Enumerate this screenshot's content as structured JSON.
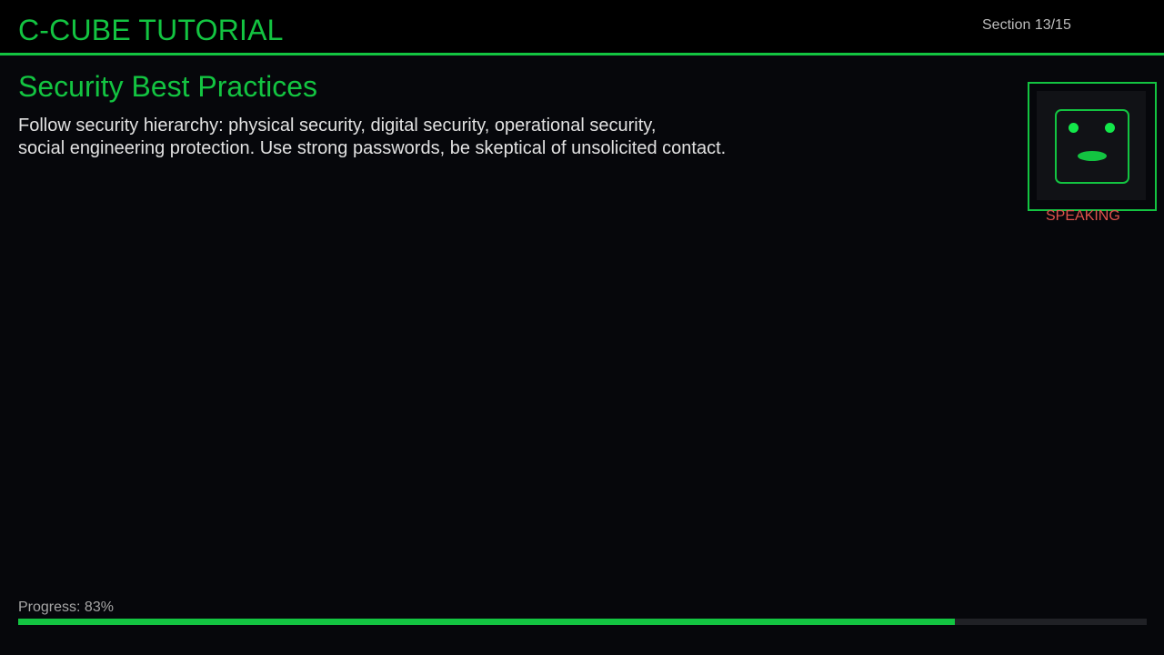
{
  "header": {
    "app_title": "C-CUBE TUTORIAL",
    "section_counter": "Section 13/15"
  },
  "content": {
    "title": "Security Best Practices",
    "body_lines": [
      "Follow security hierarchy: physical security, digital security, operational security,",
      "social engineering protection. Use strong passwords, be skeptical of unsolicited contact."
    ]
  },
  "avatar": {
    "icon": "robot-face-icon",
    "status": "SPEAKING"
  },
  "progress": {
    "label": "Progress: 83%",
    "value": 83
  },
  "colors": {
    "accent": "#13c441",
    "status": "#e0534c",
    "background": "#06070b"
  }
}
